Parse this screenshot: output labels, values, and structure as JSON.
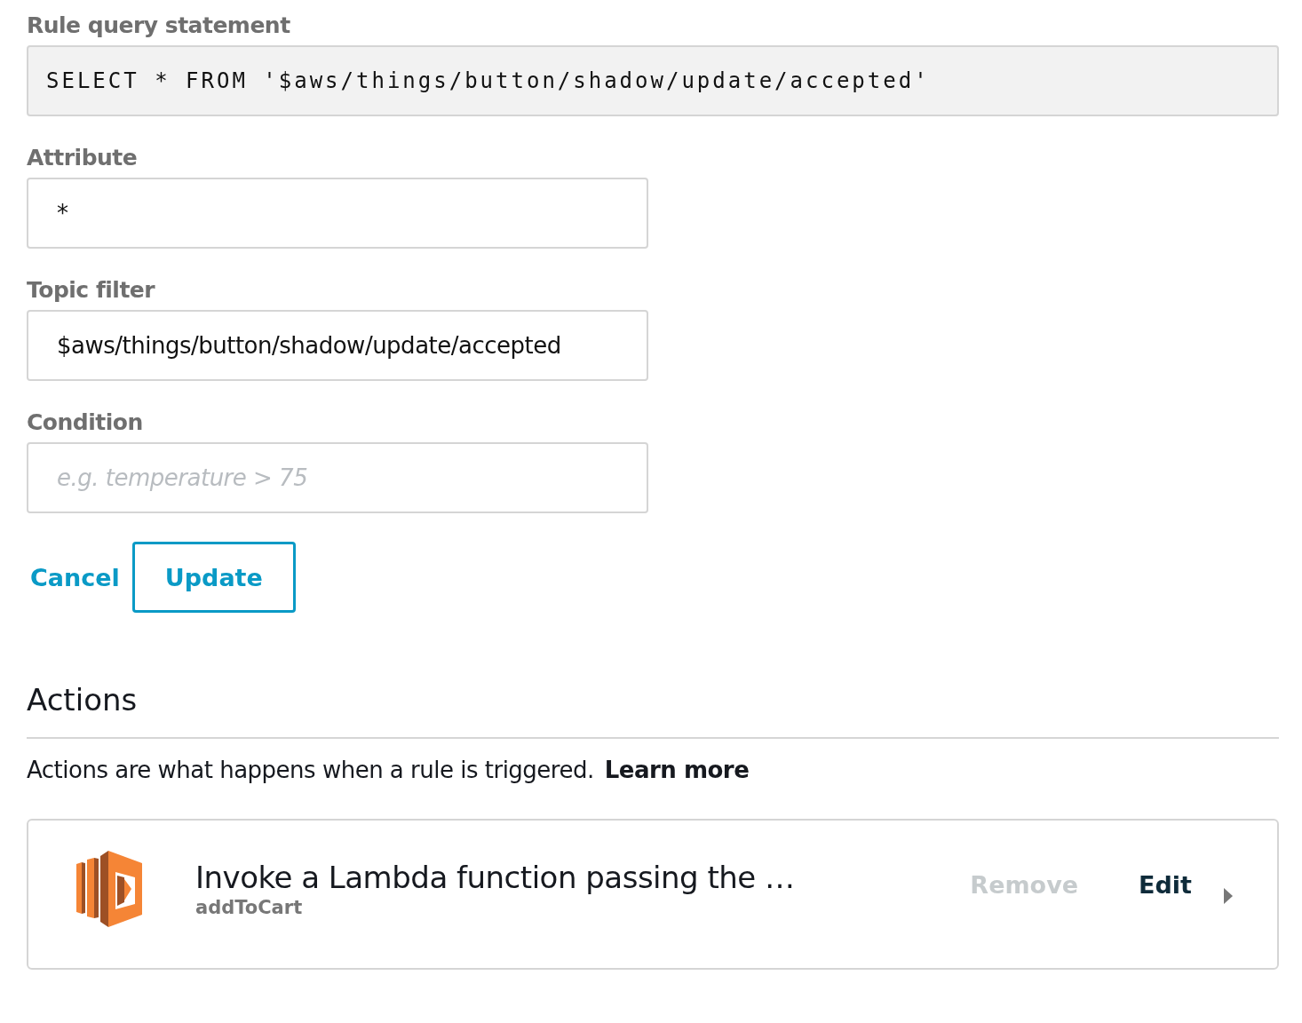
{
  "rule_query": {
    "label": "Rule query statement",
    "value": "SELECT * FROM '$aws/things/button/shadow/update/accepted'"
  },
  "fields": [
    {
      "label": "Attribute",
      "value": "*"
    },
    {
      "label": "Topic filter",
      "value": "$aws/things/button/shadow/update/accepted"
    },
    {
      "label": "Condition",
      "placeholder": "e.g. temperature > 75"
    }
  ],
  "buttons": {
    "cancel": "Cancel",
    "update": "Update"
  },
  "actions": {
    "title": "Actions",
    "description": "Actions are what happens when a rule is triggered.",
    "learn_more": "Learn more",
    "items": [
      {
        "title": "Invoke a Lambda function passing the …",
        "subtitle": "addToCart",
        "remove": "Remove",
        "remove_disabled": true,
        "edit": "Edit"
      }
    ]
  }
}
